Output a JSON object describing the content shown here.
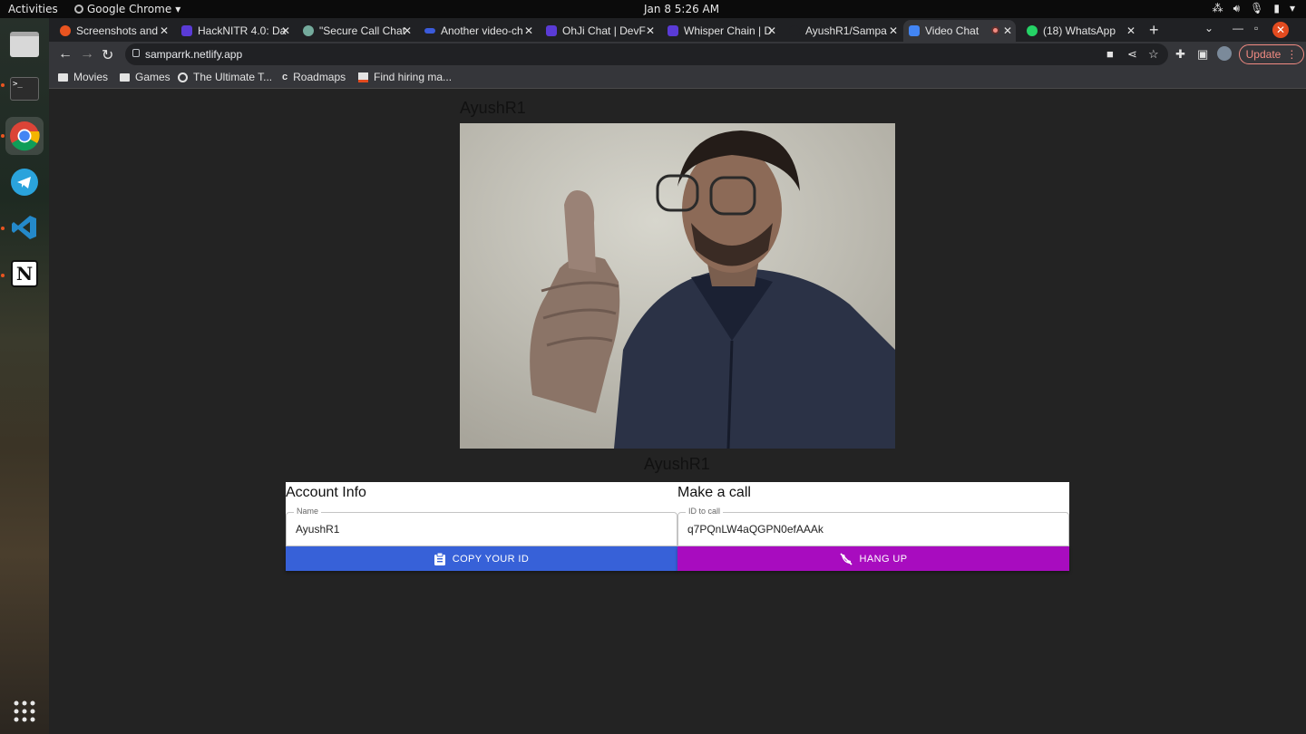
{
  "system": {
    "activities": "Activities",
    "app_name": "Google Chrome",
    "clock": "Jan 8  5:26 AM"
  },
  "dock": {
    "items": [
      "files-icon",
      "terminal-icon",
      "chrome-icon",
      "telegram-icon",
      "vscode-icon",
      "notion-icon",
      "apps-grid-icon"
    ]
  },
  "browser": {
    "tabs": [
      {
        "title": "Screenshots and",
        "favicon_color": "#e95420"
      },
      {
        "title": "HackNITR 4.0: Da",
        "favicon_color": "#5a3bd6"
      },
      {
        "title": "\"Secure Call Chat",
        "favicon_color": "#74aa9c"
      },
      {
        "title": "Another video-ch",
        "favicon_color": "#3b5bdb"
      },
      {
        "title": "OhJi Chat | DevF",
        "favicon_color": "#5a3bd6"
      },
      {
        "title": "Whisper Chain | D",
        "favicon_color": "#5a3bd6"
      },
      {
        "title": "AyushR1/Sampa",
        "favicon_color": "#202124"
      },
      {
        "title": "Video Chat",
        "favicon_color": "#4285f4"
      },
      {
        "title": "(18) WhatsApp",
        "favicon_color": "#25d366"
      }
    ],
    "active_tab_index": 7,
    "url": "samparrk.netlify.app",
    "update_label": "Update",
    "bookmarks": [
      {
        "label": "Movies",
        "icon": "folder-icon"
      },
      {
        "label": "Games",
        "icon": "folder-icon"
      },
      {
        "label": "The Ultimate T...",
        "icon": "globe-icon"
      },
      {
        "label": "Roadmaps",
        "icon": "roadmap-icon"
      },
      {
        "label": "Find hiring ma...",
        "icon": "page-icon"
      }
    ]
  },
  "app": {
    "caller_name": "AyushR1",
    "remote_name": "AyushR1",
    "account": {
      "heading": "Account Info",
      "name_label": "Name",
      "name_value": "AyushR1",
      "copy_button": "COPY YOUR ID"
    },
    "call": {
      "heading": "Make a call",
      "id_label": "ID to call",
      "id_value": "q7PQnLW4aQGPN0efAAAk",
      "hangup_button": "HANG UP"
    }
  }
}
